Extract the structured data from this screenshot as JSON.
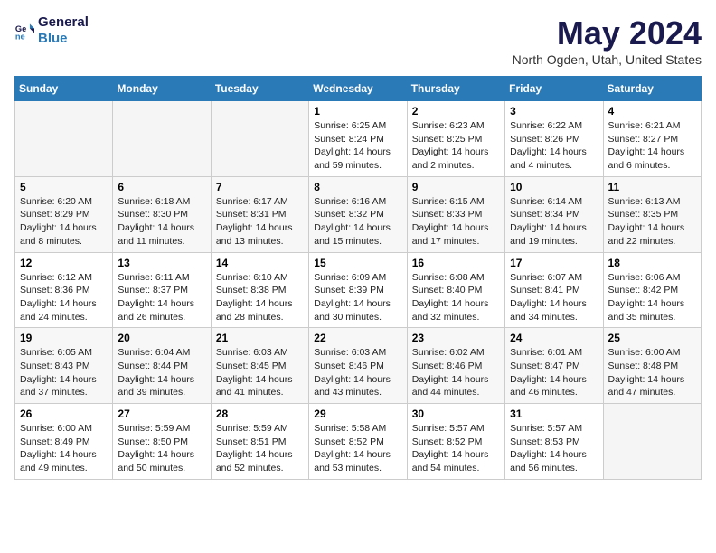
{
  "header": {
    "logo_general": "General",
    "logo_blue": "Blue",
    "title": "May 2024",
    "subtitle": "North Ogden, Utah, United States"
  },
  "weekdays": [
    "Sunday",
    "Monday",
    "Tuesday",
    "Wednesday",
    "Thursday",
    "Friday",
    "Saturday"
  ],
  "weeks": [
    [
      {
        "day": "",
        "info": ""
      },
      {
        "day": "",
        "info": ""
      },
      {
        "day": "",
        "info": ""
      },
      {
        "day": "1",
        "info": "Sunrise: 6:25 AM\nSunset: 8:24 PM\nDaylight: 14 hours\nand 59 minutes."
      },
      {
        "day": "2",
        "info": "Sunrise: 6:23 AM\nSunset: 8:25 PM\nDaylight: 14 hours\nand 2 minutes."
      },
      {
        "day": "3",
        "info": "Sunrise: 6:22 AM\nSunset: 8:26 PM\nDaylight: 14 hours\nand 4 minutes."
      },
      {
        "day": "4",
        "info": "Sunrise: 6:21 AM\nSunset: 8:27 PM\nDaylight: 14 hours\nand 6 minutes."
      }
    ],
    [
      {
        "day": "5",
        "info": "Sunrise: 6:20 AM\nSunset: 8:29 PM\nDaylight: 14 hours\nand 8 minutes."
      },
      {
        "day": "6",
        "info": "Sunrise: 6:18 AM\nSunset: 8:30 PM\nDaylight: 14 hours\nand 11 minutes."
      },
      {
        "day": "7",
        "info": "Sunrise: 6:17 AM\nSunset: 8:31 PM\nDaylight: 14 hours\nand 13 minutes."
      },
      {
        "day": "8",
        "info": "Sunrise: 6:16 AM\nSunset: 8:32 PM\nDaylight: 14 hours\nand 15 minutes."
      },
      {
        "day": "9",
        "info": "Sunrise: 6:15 AM\nSunset: 8:33 PM\nDaylight: 14 hours\nand 17 minutes."
      },
      {
        "day": "10",
        "info": "Sunrise: 6:14 AM\nSunset: 8:34 PM\nDaylight: 14 hours\nand 19 minutes."
      },
      {
        "day": "11",
        "info": "Sunrise: 6:13 AM\nSunset: 8:35 PM\nDaylight: 14 hours\nand 22 minutes."
      }
    ],
    [
      {
        "day": "12",
        "info": "Sunrise: 6:12 AM\nSunset: 8:36 PM\nDaylight: 14 hours\nand 24 minutes."
      },
      {
        "day": "13",
        "info": "Sunrise: 6:11 AM\nSunset: 8:37 PM\nDaylight: 14 hours\nand 26 minutes."
      },
      {
        "day": "14",
        "info": "Sunrise: 6:10 AM\nSunset: 8:38 PM\nDaylight: 14 hours\nand 28 minutes."
      },
      {
        "day": "15",
        "info": "Sunrise: 6:09 AM\nSunset: 8:39 PM\nDaylight: 14 hours\nand 30 minutes."
      },
      {
        "day": "16",
        "info": "Sunrise: 6:08 AM\nSunset: 8:40 PM\nDaylight: 14 hours\nand 32 minutes."
      },
      {
        "day": "17",
        "info": "Sunrise: 6:07 AM\nSunset: 8:41 PM\nDaylight: 14 hours\nand 34 minutes."
      },
      {
        "day": "18",
        "info": "Sunrise: 6:06 AM\nSunset: 8:42 PM\nDaylight: 14 hours\nand 35 minutes."
      }
    ],
    [
      {
        "day": "19",
        "info": "Sunrise: 6:05 AM\nSunset: 8:43 PM\nDaylight: 14 hours\nand 37 minutes."
      },
      {
        "day": "20",
        "info": "Sunrise: 6:04 AM\nSunset: 8:44 PM\nDaylight: 14 hours\nand 39 minutes."
      },
      {
        "day": "21",
        "info": "Sunrise: 6:03 AM\nSunset: 8:45 PM\nDaylight: 14 hours\nand 41 minutes."
      },
      {
        "day": "22",
        "info": "Sunrise: 6:03 AM\nSunset: 8:46 PM\nDaylight: 14 hours\nand 43 minutes."
      },
      {
        "day": "23",
        "info": "Sunrise: 6:02 AM\nSunset: 8:46 PM\nDaylight: 14 hours\nand 44 minutes."
      },
      {
        "day": "24",
        "info": "Sunrise: 6:01 AM\nSunset: 8:47 PM\nDaylight: 14 hours\nand 46 minutes."
      },
      {
        "day": "25",
        "info": "Sunrise: 6:00 AM\nSunset: 8:48 PM\nDaylight: 14 hours\nand 47 minutes."
      }
    ],
    [
      {
        "day": "26",
        "info": "Sunrise: 6:00 AM\nSunset: 8:49 PM\nDaylight: 14 hours\nand 49 minutes."
      },
      {
        "day": "27",
        "info": "Sunrise: 5:59 AM\nSunset: 8:50 PM\nDaylight: 14 hours\nand 50 minutes."
      },
      {
        "day": "28",
        "info": "Sunrise: 5:59 AM\nSunset: 8:51 PM\nDaylight: 14 hours\nand 52 minutes."
      },
      {
        "day": "29",
        "info": "Sunrise: 5:58 AM\nSunset: 8:52 PM\nDaylight: 14 hours\nand 53 minutes."
      },
      {
        "day": "30",
        "info": "Sunrise: 5:57 AM\nSunset: 8:52 PM\nDaylight: 14 hours\nand 54 minutes."
      },
      {
        "day": "31",
        "info": "Sunrise: 5:57 AM\nSunset: 8:53 PM\nDaylight: 14 hours\nand 56 minutes."
      },
      {
        "day": "",
        "info": ""
      }
    ]
  ]
}
